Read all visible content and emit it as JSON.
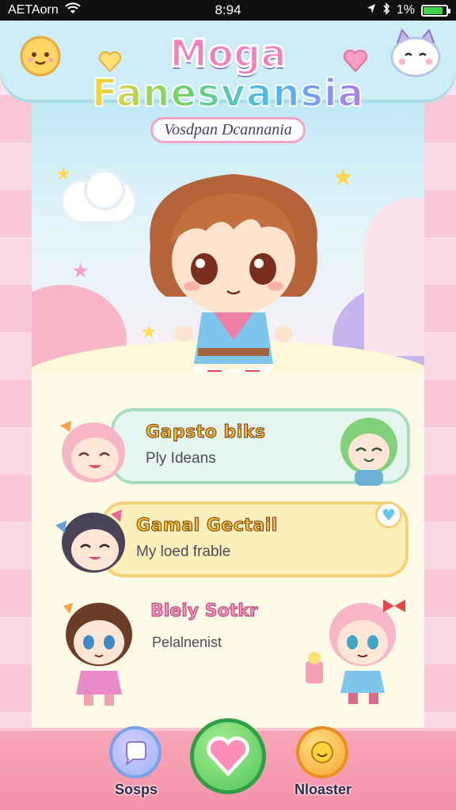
{
  "status_bar": {
    "carrier": "AETAorn",
    "time": "8:94",
    "battery": "1%"
  },
  "title": {
    "line1": "Moga",
    "line2": "Fanesvansia",
    "subtitle": "Vosdpan Dcannania"
  },
  "cards": [
    {
      "title": "Gapsto biks",
      "subtitle": "Ply Ideans"
    },
    {
      "title": "Gamal Gectail",
      "subtitle": "My loed frable"
    },
    {
      "title": "Bleiy Sotkr",
      "subtitle": "Pelalnenist"
    }
  ],
  "nav": {
    "left_label": "Sosps",
    "right_label": "Nloaster"
  },
  "colors": {
    "accent_pink": "#f27fc0",
    "card_green": "#e5f6ee",
    "card_yellow": "#fcefb9",
    "nav_bg": "#f493a9"
  }
}
